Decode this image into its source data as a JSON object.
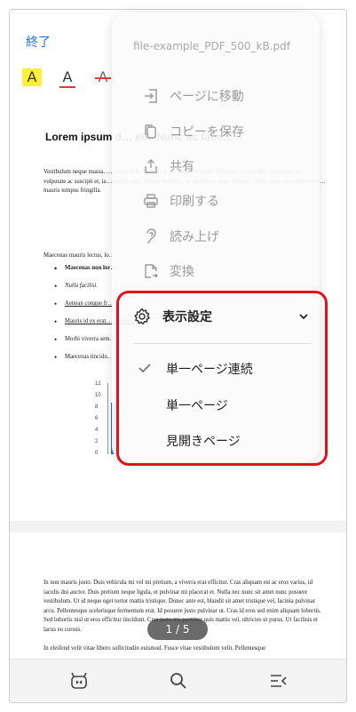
{
  "topbar": {
    "done_label": "終了",
    "tool_highlight": "A",
    "tool_underline": "A",
    "tool_strike": "A"
  },
  "document": {
    "title": "Lorem ipsum d… elit. Nunc ac faue…",
    "para1": "Vestibulum neque massa, … varius sem. Nullam at p… condimentum. Vivamus … convallis. Maecenas se… vulputate ac suscipit et, ia… nisl blandit. Integer lacinia… ac accumsan nunc vehicu… tortor quis risus auctor con… mauris tempus fringilla.",
    "para2": "Maecenas mauris lectus, lo…",
    "bullets": [
      "Maecenas non lor…",
      "Nulla facilisi.",
      "Aenean congue fr…",
      "Mauris id ex erat. … sagittis.",
      "Morbi viverra sem…",
      "Maecenas tincidu…"
    ],
    "para3": "In non mauris justo. Duis vehicula mi vel mi pretium, a viverra erat efficitur. Cras aliquam est ac eros varius, id iaculis dui auctor. Duis pretium neque ligula, et pulvinar mi placerat et. Nulla nec nunc sit amet nunc posuere vestibulum. Ut id neque eget tortor mattis tristique. Donec ante est, blandit sit amet tristique vel, lacinia pulvinar arcu. Pellentesque scelerisque fermentum erat. Id posuere justo pulvinar ut. Cras id eros sed enim aliquam lobortis. Sed lobortis nisl ut eros efficitur tincidunt. Cras justo mi, porttitor quis mattis vel, ultricies ut purus. Ut facilisis et lacus eu cursus.",
    "para4": "In eleifend velit vitae libero sollicitudin euismod. Fusce vitae vestibulum velit. Pellentesque"
  },
  "chart_data": {
    "type": "bar",
    "yticks": [
      "12",
      "10",
      "8",
      "6",
      "4",
      "2",
      "0"
    ]
  },
  "pager": {
    "label": "1 / 5"
  },
  "menu": {
    "filename": "file-example_PDF_500_kB.pdf",
    "items": [
      {
        "label": "ページに移動",
        "icon": "goto-page-icon"
      },
      {
        "label": "コピーを保存",
        "icon": "copy-icon"
      },
      {
        "label": "共有",
        "icon": "share-icon"
      },
      {
        "label": "印刷する",
        "icon": "print-icon"
      },
      {
        "label": "読み上げ",
        "icon": "read-aloud-icon"
      },
      {
        "label": "変換",
        "icon": "convert-icon"
      }
    ],
    "display_settings": {
      "label": "表示設定",
      "options": [
        "単一ページ連続",
        "単一ページ",
        "見開きページ"
      ],
      "selected": "単一ページ連続"
    }
  },
  "bottombar": {
    "icons": [
      "bot-icon",
      "search-icon",
      "menu-collapse-icon"
    ]
  },
  "colors": {
    "accent": "#1a73e8",
    "highlight": "#ffee3a",
    "annotation_red": "#e0121b"
  }
}
